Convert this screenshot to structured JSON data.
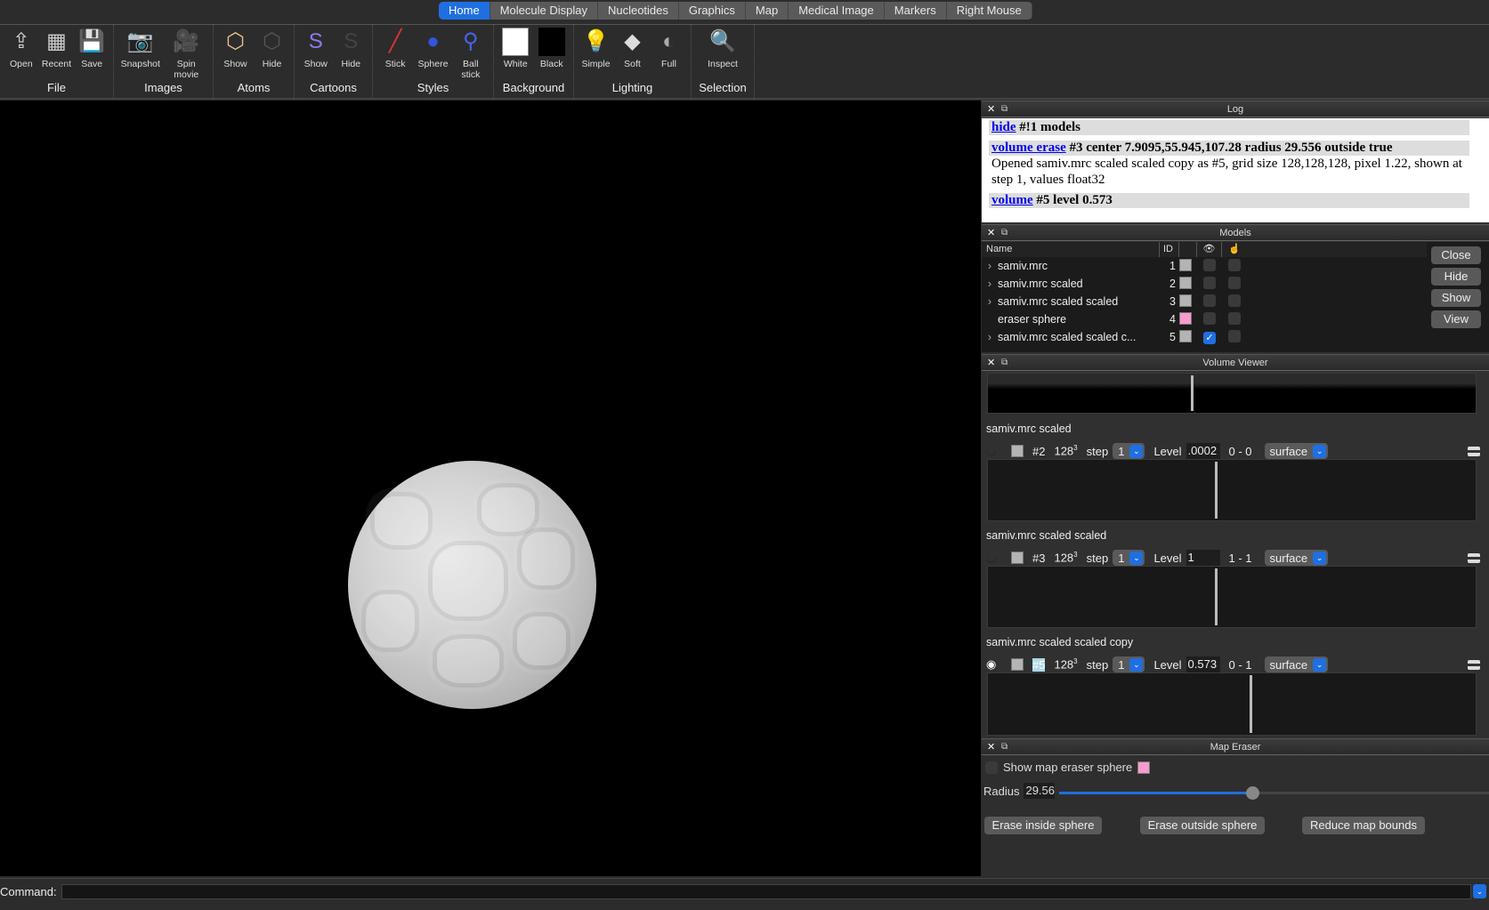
{
  "tabs": [
    "Home",
    "Molecule Display",
    "Nucleotides",
    "Graphics",
    "Map",
    "Medical Image",
    "Markers",
    "Right Mouse"
  ],
  "ribbon": [
    {
      "group": "File",
      "items": [
        {
          "label": "Open",
          "icon": "open-icon"
        },
        {
          "label": "Recent",
          "icon": "recent-icon"
        },
        {
          "label": "Save",
          "icon": "save-icon"
        }
      ]
    },
    {
      "group": "Images",
      "items": [
        {
          "label": "Snapshot",
          "icon": "camera-icon"
        },
        {
          "label": "Spin movie",
          "icon": "movie-camera-icon"
        }
      ]
    },
    {
      "group": "Atoms",
      "items": [
        {
          "label": "Show",
          "icon": "atoms-show-icon"
        },
        {
          "label": "Hide",
          "icon": "atoms-hide-icon"
        }
      ]
    },
    {
      "group": "Cartoons",
      "items": [
        {
          "label": "Show",
          "icon": "cartoon-show-icon"
        },
        {
          "label": "Hide",
          "icon": "cartoon-hide-icon"
        }
      ]
    },
    {
      "group": "Styles",
      "items": [
        {
          "label": "Stick",
          "icon": "stick-icon"
        },
        {
          "label": "Sphere",
          "icon": "sphere-icon"
        },
        {
          "label": "Ball stick",
          "icon": "ball-stick-icon"
        }
      ]
    },
    {
      "group": "Background",
      "items": [
        {
          "label": "White",
          "icon": "white-swatch-icon"
        },
        {
          "label": "Black",
          "icon": "black-swatch-icon"
        }
      ]
    },
    {
      "group": "Lighting",
      "items": [
        {
          "label": "Simple",
          "icon": "simple-light-icon"
        },
        {
          "label": "Soft",
          "icon": "soft-light-icon"
        },
        {
          "label": "Full",
          "icon": "full-light-icon"
        }
      ]
    },
    {
      "group": "Selection",
      "items": [
        {
          "label": "Inspect",
          "icon": "magnifier-icon"
        }
      ]
    }
  ],
  "log": {
    "title": "Log",
    "entries": [
      {
        "link": "hide",
        "rest": " #!1 models"
      },
      {
        "link": "volume erase",
        "rest": " #3 center 7.9095,55.945,107.28 radius 29.556 outside true",
        "msg": "Opened samiv.mrc scaled scaled copy as #5, grid size 128,128,128, pixel 1.22, shown at step 1, values float32"
      },
      {
        "link": "volume",
        "rest": " #5 level 0.573"
      }
    ]
  },
  "models": {
    "title": "Models",
    "headers": {
      "name": "Name",
      "id": "ID"
    },
    "rows": [
      {
        "name": "samiv.mrc",
        "id": "1",
        "color": "#b4b4b4",
        "shown": false,
        "expand": true
      },
      {
        "name": "samiv.mrc scaled",
        "id": "2",
        "color": "#b4b4b4",
        "shown": false,
        "expand": true
      },
      {
        "name": "samiv.mrc scaled scaled",
        "id": "3",
        "color": "#b4b4b4",
        "shown": false,
        "expand": true
      },
      {
        "name": "eraser sphere",
        "id": "4",
        "color": "#f59ccc",
        "shown": false,
        "expand": false
      },
      {
        "name": "samiv.mrc scaled scaled c...",
        "id": "5",
        "color": "#b4b4b4",
        "shown": true,
        "expand": true
      }
    ],
    "buttons": [
      "Close",
      "Hide",
      "Show",
      "View"
    ]
  },
  "volume_viewer": {
    "title": "Volume Viewer",
    "step_label": "step",
    "level_label": "Level",
    "maps": [
      {
        "name": "samiv.mrc scaled",
        "id": "#2",
        "size": "128",
        "step": "1",
        "level": ".0002",
        "range": "0 - 0",
        "style": "surface",
        "visible": false
      },
      {
        "name": "samiv.mrc scaled scaled",
        "id": "#3",
        "size": "128",
        "step": "1",
        "level": "1",
        "range": "1 - 1",
        "style": "surface",
        "visible": false
      },
      {
        "name": "samiv.mrc scaled scaled copy",
        "id": "#5",
        "size": "128",
        "step": "1",
        "level": "0.573",
        "range": "0 - 1",
        "style": "surface",
        "visible": true
      }
    ]
  },
  "map_eraser": {
    "title": "Map Eraser",
    "show_label": "Show map eraser sphere",
    "sphere_color": "#f59ccc",
    "radius_label": "Radius",
    "radius": "29.56",
    "slider_fraction": 0.45,
    "buttons": [
      "Erase inside sphere",
      "Erase outside sphere",
      "Reduce map bounds"
    ]
  },
  "command": {
    "label": "Command:",
    "value": ""
  },
  "accent": "#1f6fe0"
}
